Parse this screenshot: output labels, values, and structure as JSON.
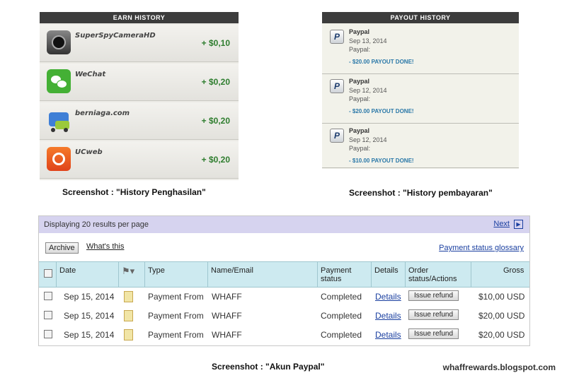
{
  "earn_history": {
    "title": "EARN HISTORY",
    "items": [
      {
        "app": "SuperSpyCameraHD",
        "amount": "+ $0,10",
        "icon": "camera-app-icon"
      },
      {
        "app": "WeChat",
        "amount": "+ $0,20",
        "icon": "wechat-app-icon"
      },
      {
        "app": "berniaga.com",
        "amount": "+ $0,20",
        "icon": "berniaga-app-icon"
      },
      {
        "app": "UCweb",
        "amount": "+ $0,20",
        "icon": "ucweb-app-icon"
      }
    ],
    "caption": "Screenshot : \"History Penghasilan\""
  },
  "payout_history": {
    "title": "PAYOUT HISTORY",
    "items": [
      {
        "method": "Paypal",
        "date": "Sep 13, 2014",
        "label": "Paypal:",
        "status": "- $20.00 PAYOUT DONE!"
      },
      {
        "method": "Paypal",
        "date": "Sep 12, 2014",
        "label": "Paypal:",
        "status": "- $20.00 PAYOUT DONE!"
      },
      {
        "method": "Paypal",
        "date": "Sep 12, 2014",
        "label": "Paypal:",
        "status": "- $10.00 PAYOUT DONE!"
      }
    ],
    "caption": "Screenshot : \"History pembayaran\""
  },
  "paypal": {
    "display_text": "Displaying 20 results per page",
    "next_label": "Next",
    "archive_label": "Archive",
    "whats_this": "What's this",
    "glossary_link": "Payment status glossary",
    "columns": {
      "date": "Date",
      "type": "Type",
      "name": "Name/Email",
      "payment_status": "Payment status",
      "details": "Details",
      "order_status": "Order status/Actions",
      "gross": "Gross"
    },
    "rows": [
      {
        "date": "Sep 15, 2014",
        "type": "Payment From",
        "name": "WHAFF",
        "status": "Completed",
        "details": "Details",
        "action": "Issue refund",
        "gross": "$10,00 USD"
      },
      {
        "date": "Sep 15, 2014",
        "type": "Payment From",
        "name": "WHAFF",
        "status": "Completed",
        "details": "Details",
        "action": "Issue refund",
        "gross": "$20,00 USD"
      },
      {
        "date": "Sep 15, 2014",
        "type": "Payment From",
        "name": "WHAFF",
        "status": "Completed",
        "details": "Details",
        "action": "Issue refund",
        "gross": "$20,00 USD"
      }
    ],
    "caption": "Screenshot : \"Akun Paypal\""
  },
  "footer": {
    "site": "whaffrewards.blogspot.com"
  },
  "colors": {
    "amount_green": "#2e7d2e",
    "payout_blue": "#2a78a8",
    "header_purple": "#d6d3ef",
    "table_header": "#cdeaf0"
  }
}
